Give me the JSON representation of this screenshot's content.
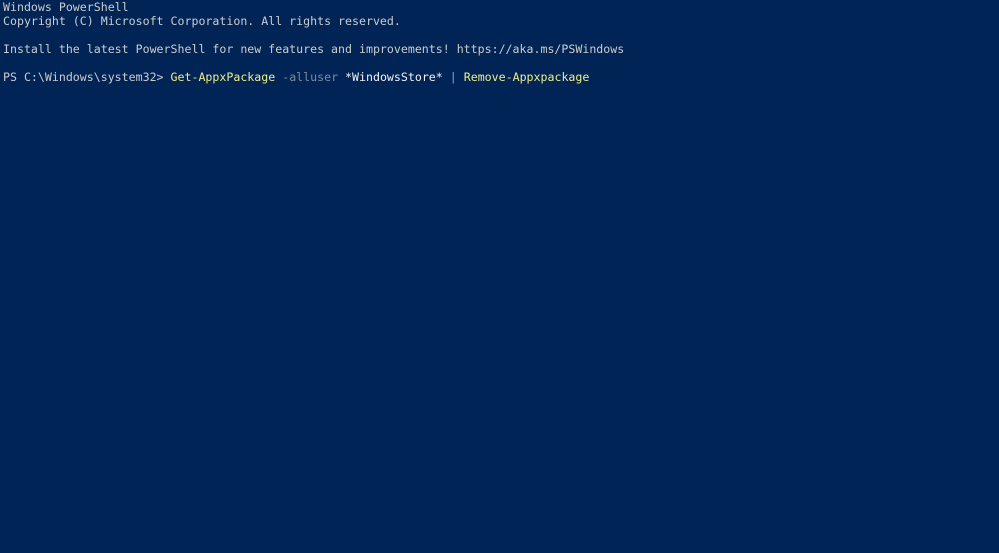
{
  "window": {
    "title": "Windows PowerShell",
    "background_color": "#012456",
    "foreground_color": "#cccccc"
  },
  "colors": {
    "background": "#012456",
    "default_text": "#cccccc",
    "bright_text": "#f2f2f2",
    "command_token": "#eeee88",
    "parameter_token": "#7f8a99",
    "operator_token": "#92a2b4"
  },
  "console": {
    "lines": [
      {
        "type": "text",
        "text": "Windows PowerShell"
      },
      {
        "type": "text",
        "text": "Copyright (C) Microsoft Corporation. All rights reserved."
      },
      {
        "type": "blank",
        "text": ""
      },
      {
        "type": "text",
        "text": "Install the latest PowerShell for new features and improvements! https://aka.ms/PSWindows"
      },
      {
        "type": "blank",
        "text": ""
      },
      {
        "type": "prompt",
        "segments": [
          {
            "token": "default",
            "text": "PS C:\\Windows\\system32> "
          },
          {
            "token": "command",
            "text": "Get-AppxPackage"
          },
          {
            "token": "default",
            "text": " "
          },
          {
            "token": "parameter",
            "text": "-alluser"
          },
          {
            "token": "default",
            "text": " "
          },
          {
            "token": "bright",
            "text": "*WindowsStore*"
          },
          {
            "token": "default",
            "text": " "
          },
          {
            "token": "operator",
            "text": "|"
          },
          {
            "token": "default",
            "text": " "
          },
          {
            "token": "command",
            "text": "Remove-Appxpackage"
          }
        ]
      }
    ],
    "prompt_text": "PS C:\\Windows\\system32>",
    "current_command": "Get-AppxPackage -alluser *WindowsStore* | Remove-Appxpackage",
    "banner_line_1": "Windows PowerShell",
    "banner_line_2": "Copyright (C) Microsoft Corporation. All rights reserved.",
    "banner_line_3": "Install the latest PowerShell for new features and improvements! https://aka.ms/PSWindows",
    "upgrade_url": "https://aka.ms/PSWindows"
  }
}
